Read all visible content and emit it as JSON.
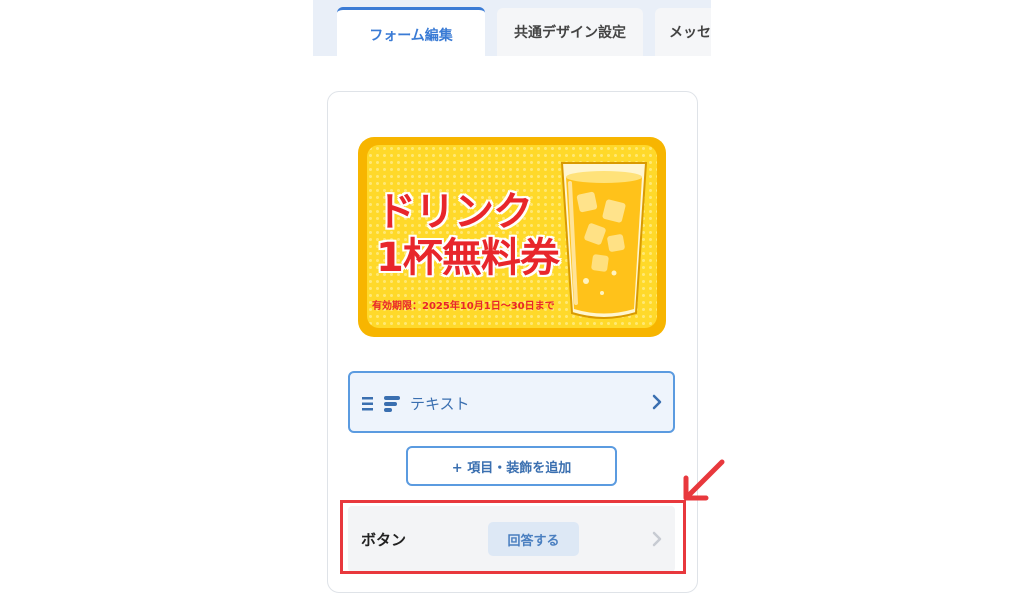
{
  "tabs": [
    {
      "label": "フォーム編集",
      "active": true
    },
    {
      "label": "共通デザイン設定",
      "active": false
    },
    {
      "label": "メッセ",
      "active": false
    }
  ],
  "coupon": {
    "title_line1": "ドリンク",
    "title_line2": "1杯無料券",
    "validity": "有効期限：2025年10月1日〜30日まで"
  },
  "text_item": {
    "icon": "text-block-icon",
    "label": "テキスト"
  },
  "add_button": {
    "label": "+ 項目・装飾を追加"
  },
  "button_item": {
    "label": "ボタン",
    "value": "回答する"
  },
  "colors": {
    "accent": "#3a7bd5",
    "highlight": "#e8383d",
    "coupon_bg": "#ffd92a",
    "coupon_text": "#e8262b"
  }
}
